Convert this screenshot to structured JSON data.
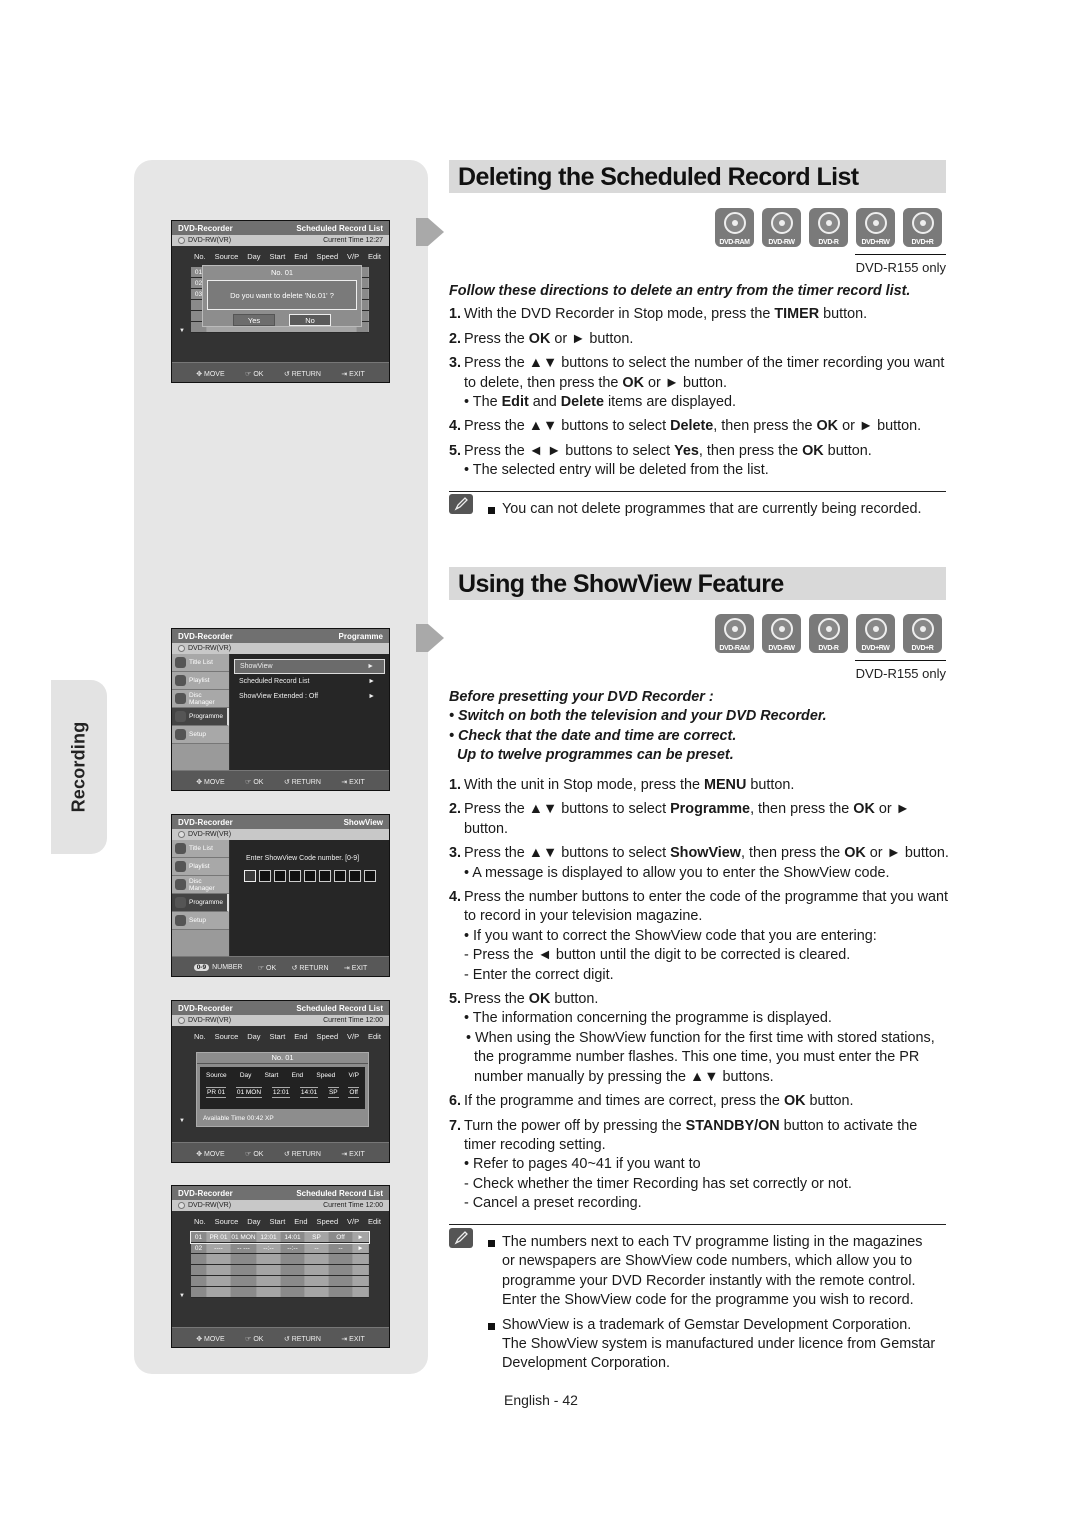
{
  "side_tab": {
    "label": "Recording"
  },
  "osd_common": {
    "brand": "DVD-Recorder",
    "disc": "DVD-RW(VR)",
    "footer": {
      "move": "MOVE",
      "ok": "OK",
      "return": "RETURN",
      "exit": "EXIT",
      "number": "NUMBER",
      "number_badge": "0-9"
    },
    "columns": [
      "No.",
      "Source",
      "Day",
      "Start",
      "End",
      "Speed",
      "V/P",
      "Edit"
    ]
  },
  "screen1": {
    "title": "Scheduled Record List",
    "current_time": "Current Time  12:27",
    "rows": [
      "01",
      "02",
      "03",
      "",
      "",
      ""
    ],
    "dialog_title": "No. 01",
    "dialog_message": "Do you want to delete 'No.01' ?",
    "yes_label": "Yes",
    "no_label": "No"
  },
  "screen2": {
    "title": "Programme",
    "side_menu": [
      "Title List",
      "Playlist",
      "Disc Manager",
      "Programme",
      "Setup"
    ],
    "active_side": "Programme",
    "options": [
      {
        "label": "ShowView",
        "arrow": "►"
      },
      {
        "label": "Scheduled Record List",
        "arrow": "►"
      },
      {
        "label": "ShowView Extended : Off",
        "arrow": "►"
      }
    ]
  },
  "screen3": {
    "title": "ShowView",
    "side_menu": [
      "Title List",
      "Playlist",
      "Disc Manager",
      "Programme",
      "Setup"
    ],
    "prompt": "Enter ShowView Code number. [0-9]",
    "code_digits": 9
  },
  "screen4": {
    "title": "Scheduled Record List",
    "current_time": "Current Time  12:00",
    "box_title": "No. 01",
    "fields": [
      "Source",
      "Day",
      "Start",
      "End",
      "Speed",
      "V/P"
    ],
    "values": [
      "PR 01",
      "01 MON",
      "12:01",
      "14:01",
      "SP",
      "Off"
    ],
    "available_time": "Available Time   00:42   XP"
  },
  "screen5": {
    "title": "Scheduled Record List",
    "current_time": "Current Time  12:00",
    "rows": [
      [
        "01",
        "PR 01",
        "01 MON",
        "12:01",
        "14:01",
        "SP",
        "Off",
        "►"
      ],
      [
        "02",
        "----",
        "-- ---",
        "--:--",
        "--:--",
        "--",
        "--",
        "►"
      ],
      [
        "",
        "",
        "",
        "",
        "",
        "",
        "",
        ""
      ],
      [
        "",
        "",
        "",
        "",
        "",
        "",
        "",
        ""
      ],
      [
        "",
        "",
        "",
        "",
        "",
        "",
        "",
        ""
      ],
      [
        "",
        "",
        "",
        "",
        "",
        "",
        "",
        ""
      ]
    ]
  },
  "section1": {
    "title": "Deleting the Scheduled Record List",
    "discs": [
      "DVD-RAM",
      "DVD-RW",
      "DVD-R",
      "DVD+RW",
      "DVD+R"
    ],
    "model_note": "DVD-R155 only",
    "intro": "Follow these directions to delete an entry from the timer record list.",
    "steps": [
      {
        "n": "1.",
        "html": "With the DVD Recorder in Stop mode, press the <b>TIMER</b> button."
      },
      {
        "n": "2.",
        "html": "Press the <b>OK</b> or ► button."
      },
      {
        "n": "3.",
        "html": "Press the ▲▼ buttons to select the number of the timer recording you want to delete, then press the <b>OK</b> or ► button.<span class='bullet'>• The <b>Edit</b> and <b>Delete</b> items are displayed.</span>"
      },
      {
        "n": "4.",
        "html": "Press the ▲▼ buttons to select <b>Delete</b>, then press the <b>OK</b> or ► button."
      },
      {
        "n": "5.",
        "html": "Press the ◄ ► buttons to select <b>Yes</b>, then press the <b>OK</b> button.<span class='bullet'>• The selected entry will be deleted from the list.</span>"
      }
    ],
    "note": "You can not delete programmes that are currently being recorded."
  },
  "section2": {
    "title": "Using the ShowView Feature",
    "discs": [
      "DVD-RAM",
      "DVD-RW",
      "DVD-R",
      "DVD+RW",
      "DVD+R"
    ],
    "model_note": "DVD-R155 only",
    "before_title": "Before presetting your DVD Recorder :",
    "before_items": [
      "• Switch on both the television and your DVD Recorder.",
      "• Check that the date and time are correct.",
      "  Up to twelve programmes can be preset."
    ],
    "steps": [
      {
        "n": "1.",
        "html": "With the unit in Stop mode, press the <b>MENU</b> button."
      },
      {
        "n": "2.",
        "html": "Press the ▲▼ buttons to select <b>Programme</b>, then press the <b>OK</b> or ► button."
      },
      {
        "n": "3.",
        "html": "Press the ▲▼ buttons to select <b>ShowView</b>, then press the <b>OK</b> or ► button.<span class='bullet'>• A message is displayed to allow you to enter the ShowView code.</span>"
      },
      {
        "n": "4.",
        "html": "Press the number buttons to enter the code of the programme that you want to record in your television magazine.<span class='bullet'>• If you want to correct the ShowView code that you are entering:</span><span class='bullet'>- Press the ◄ button until the digit to be corrected is cleared.</span><span class='bullet'>- Enter the correct digit.</span>"
      },
      {
        "n": "5.",
        "html": "Press the <b>OK</b> button.<span class='bullet'>• The information concerning the programme is displayed.</span><span class='sub-b2'>• When using the ShowView function for the first time with stored stations, the programme number flashes. This one time, you must enter the PR number manually by pressing the ▲▼ buttons.</span>"
      },
      {
        "n": "6.",
        "html": "If the programme and times are correct, press the <b>OK</b> button."
      },
      {
        "n": "7.",
        "html": "Turn the power off by pressing the <b>STANDBY/ON</b> button to activate the timer recoding setting.<span class='bullet'>• Refer to pages 40~41 if you want to</span><span class='bullet'>- Check whether the timer Recording has set correctly or not.</span><span class='bullet'>- Cancel a preset recording.</span>"
      }
    ],
    "notes": [
      "The numbers next to each TV programme listing in the magazines or newspapers are ShowView code numbers, which allow you to programme your DVD Recorder instantly with the remote control. Enter the ShowView code for the programme you wish to record.",
      "ShowView is a trademark of Gemstar Development Corporation. The ShowView system is manufactured under licence from Gemstar Development Corporation."
    ]
  },
  "footer": {
    "page": "English - 42"
  }
}
